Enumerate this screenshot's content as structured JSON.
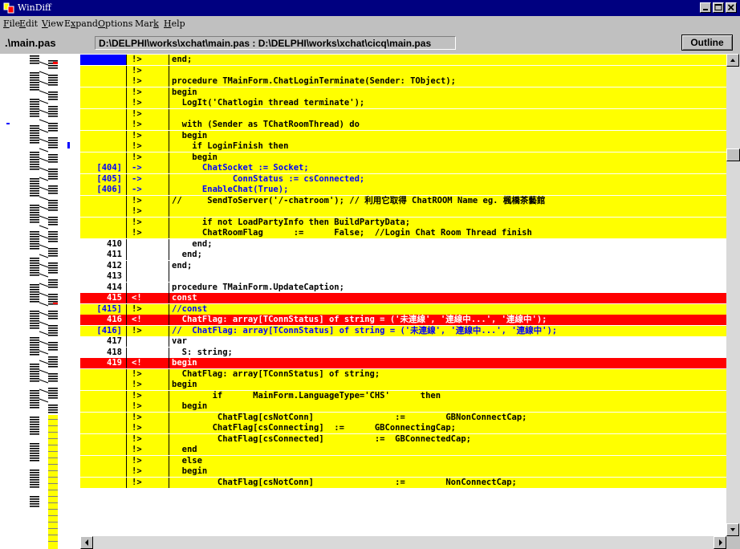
{
  "window": {
    "title": "WinDiff"
  },
  "menu": [
    {
      "label": "File",
      "u": "F"
    },
    {
      "label": "Edit",
      "u": "E"
    },
    {
      "label": "View",
      "u": "V"
    },
    {
      "label": "Expand",
      "u": "x"
    },
    {
      "label": "Options",
      "u": "O"
    },
    {
      "label": "Mark",
      "u": "k"
    },
    {
      "label": "Help",
      "u": "H"
    }
  ],
  "info": {
    "file_name": ".\\main.pas",
    "paths": "D:\\DELPHI\\works\\xchat\\main.pas : D:\\DELPHI\\works\\xchat\\cicq\\main.pas",
    "outline_label": "Outline"
  },
  "colors": {
    "moved": "#ffff00",
    "removed": "#ff0000",
    "normal": "#ffffff",
    "moved_number": "#0000ff",
    "selection": "#0000ff"
  },
  "rows": [
    {
      "ln": "",
      "mk": "!>",
      "text": "end;",
      "type": "moved",
      "sel": true
    },
    {
      "ln": "",
      "mk": "!>",
      "text": "",
      "type": "moved"
    },
    {
      "ln": "",
      "mk": "!>",
      "text": "procedure TMainForm.ChatLoginTerminate(Sender: TObject);",
      "type": "moved"
    },
    {
      "ln": "",
      "mk": "!>",
      "text": "begin",
      "type": "moved"
    },
    {
      "ln": "",
      "mk": "!>",
      "text": "  LogIt('Chatlogin thread terminate');",
      "type": "moved"
    },
    {
      "ln": "",
      "mk": "!>",
      "text": "",
      "type": "moved"
    },
    {
      "ln": "",
      "mk": "!>",
      "text": "  with (Sender as TChatRoomThread) do",
      "type": "moved"
    },
    {
      "ln": "",
      "mk": "!>",
      "text": "  begin",
      "type": "moved"
    },
    {
      "ln": "",
      "mk": "!>",
      "text": "    if LoginFinish then",
      "type": "moved"
    },
    {
      "ln": "",
      "mk": "!>",
      "text": "    begin",
      "type": "moved"
    },
    {
      "ln": "[404]",
      "mk": "->",
      "text": "      ChatSocket := Socket;",
      "type": "moved_from"
    },
    {
      "ln": "[405]",
      "mk": "->",
      "text": "            ConnStatus := csConnected;",
      "type": "moved_from"
    },
    {
      "ln": "[406]",
      "mk": "->",
      "text": "      EnableChat(True);",
      "type": "moved_from"
    },
    {
      "ln": "",
      "mk": "!>",
      "text": "//     SendToServer('/-chatroom'); // 利用它取得 ChatROOM Name eg. 楓橋茶藝館",
      "type": "moved"
    },
    {
      "ln": "",
      "mk": "!>",
      "text": "",
      "type": "moved"
    },
    {
      "ln": "",
      "mk": "!>",
      "text": "      if not LoadPartyInfo then BuildPartyData;",
      "type": "moved"
    },
    {
      "ln": "",
      "mk": "!>",
      "text": "      ChatRoomFlag      :=      False;  //Login Chat Room Thread finish",
      "type": "moved"
    },
    {
      "ln": "410",
      "mk": "",
      "text": "    end;",
      "type": "normal"
    },
    {
      "ln": "411",
      "mk": "",
      "text": "  end;",
      "type": "normal"
    },
    {
      "ln": "412",
      "mk": "",
      "text": "end;",
      "type": "normal"
    },
    {
      "ln": "413",
      "mk": "",
      "text": "",
      "type": "normal"
    },
    {
      "ln": "414",
      "mk": "",
      "text": "procedure TMainForm.UpdateCaption;",
      "type": "normal"
    },
    {
      "ln": "415",
      "mk": "<!",
      "text": "const",
      "type": "removed"
    },
    {
      "ln": "[415]",
      "mk": "!>",
      "text": "//const",
      "type": "moved_to"
    },
    {
      "ln": "416",
      "mk": "<!",
      "text": "  ChatFlag: array[TConnStatus] of string = ('未連線', '連線中...', '連線中');",
      "type": "removed"
    },
    {
      "ln": "[416]",
      "mk": "!>",
      "text": "//  ChatFlag: array[TConnStatus] of string = ('未連線', '連線中...', '連線中');",
      "type": "moved_to"
    },
    {
      "ln": "417",
      "mk": "",
      "text": "var",
      "type": "normal"
    },
    {
      "ln": "418",
      "mk": "",
      "text": "  S: string;",
      "type": "normal"
    },
    {
      "ln": "419",
      "mk": "<!",
      "text": "begin",
      "type": "removed"
    },
    {
      "ln": "",
      "mk": "!>",
      "text": "  ChatFlag: array[TConnStatus] of string;",
      "type": "moved"
    },
    {
      "ln": "",
      "mk": "!>",
      "text": "begin",
      "type": "moved"
    },
    {
      "ln": "",
      "mk": "!>",
      "text": "        if      MainForm.LanguageType='CHS'      then",
      "type": "moved"
    },
    {
      "ln": "",
      "mk": "!>",
      "text": "  begin",
      "type": "moved"
    },
    {
      "ln": "",
      "mk": "!>",
      "text": "         ChatFlag[csNotConn]                :=        GBNonConnectCap;",
      "type": "moved"
    },
    {
      "ln": "",
      "mk": "!>",
      "text": "        ChatFlag[csConnecting]  :=      GBConnectingCap;",
      "type": "moved"
    },
    {
      "ln": "",
      "mk": "!>",
      "text": "         ChatFlag[csConnected]          :=  GBConnectedCap;",
      "type": "moved"
    },
    {
      "ln": "",
      "mk": "!>",
      "text": "  end",
      "type": "moved"
    },
    {
      "ln": "",
      "mk": "!>",
      "text": "  else",
      "type": "moved"
    },
    {
      "ln": "",
      "mk": "!>",
      "text": "  begin",
      "type": "moved"
    },
    {
      "ln": "",
      "mk": "!>",
      "text": "         ChatFlag[csNotConn]                :=        NonConnectCap;",
      "type": "moved"
    }
  ]
}
